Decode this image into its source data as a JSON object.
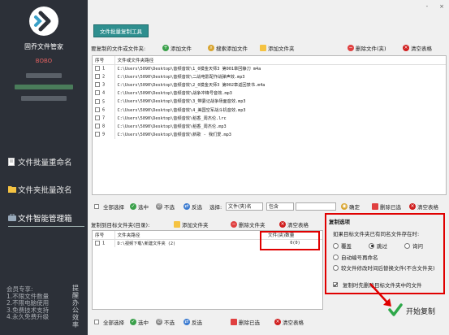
{
  "sidebar": {
    "app_name": "固乔文件管家",
    "version": "BOBO",
    "nav": [
      {
        "label": "文件批量重命名",
        "icon": "document-icon"
      },
      {
        "label": "文件夹批量改名",
        "icon": "folder-icon"
      },
      {
        "label": "文件智能管理箱",
        "icon": "toolbox-icon",
        "active": true
      }
    ],
    "promo_lines": [
      "会员专享:",
      "1.不限文件数量",
      "2.不限电脑使用",
      "3.免费技术支持",
      "4.永久免费升级"
    ],
    "promo_side": "提醒办公效率"
  },
  "window": {
    "minimize": "-",
    "close": "×"
  },
  "tab_button": "文件批量复制工具",
  "top_toolbar": {
    "label": "要复制的文件或文件夹:",
    "add_file": "添加文件",
    "search_add": "搜索添加文件",
    "add_folder": "添加文件夹",
    "delete": "删除文件(夹)",
    "clear": "清空表格"
  },
  "file_table": {
    "headers": [
      "序号",
      "文件或文件夹路径"
    ],
    "rows": [
      {
        "no": "1",
        "path": "C:\\Users\\5090\\Desktop\\音频音效\\1_0摸金天师3 第001章回静刀 m4a"
      },
      {
        "no": "2",
        "path": "C:\\Users\\5090\\Desktop\\音频音效\\二战电影配作战弹声效.mp3"
      },
      {
        "no": "3",
        "path": "C:\\Users\\5090\\Desktop\\音频音效\\2_0摸金天师3 第002章返回禁书.m4a"
      },
      {
        "no": "4",
        "path": "C:\\Users\\5090\\Desktop\\音频音效\\战争冲锋号音效.mp3"
      },
      {
        "no": "5",
        "path": "C:\\Users\\5090\\Desktop\\音频音效\\3_带委记战争场面音效.mp3"
      },
      {
        "no": "6",
        "path": "C:\\Users\\5090\\Desktop\\音频音效\\4_美国空军战斗机音效.mp3"
      },
      {
        "no": "7",
        "path": "C:\\Users\\5090\\Desktop\\音频音效\\稻香_周杰伦.lrc"
      },
      {
        "no": "8",
        "path": "C:\\Users\\5090\\Desktop\\音频音效\\稻香_周杰伦.mp3"
      },
      {
        "no": "9",
        "path": "C:\\Users\\5090\\Desktop\\音频音效\\新歌 - 我们爱.mp3"
      }
    ]
  },
  "select_bar": {
    "select_all": "全部选择",
    "select": "选中",
    "deselect": "不选",
    "invert": "反选",
    "choose_label": "选择:",
    "field_option": "文件(夹)名",
    "match_option": "包含",
    "confirm": "确定",
    "delete_selected": "删除已选",
    "clear": "清空表格"
  },
  "target_toolbar": {
    "label": "复制到目标文件夹(目录):",
    "add_folder": "添加文件夹",
    "delete": "删除文件夹",
    "clear": "清空表格"
  },
  "target_table": {
    "headers": [
      "序号",
      "文件夹路径",
      "文件(夹)数量"
    ],
    "rows": [
      {
        "no": "1",
        "path": "D:\\视频下载\\新建文件夹 (2)",
        "count": "0(0)"
      }
    ]
  },
  "bottom_bar": {
    "select_all": "全部选择",
    "select": "选中",
    "deselect": "不选",
    "invert": "反选",
    "delete_selected": "删除已选",
    "clear": "清空表格"
  },
  "options": {
    "title": "复制选项",
    "question": "如果目标文件夹已有同名文件存在时:",
    "overwrite": "覆盖",
    "skip": "跳过",
    "ask": "询问",
    "auto_rename": "自动编号再命名",
    "replace_newer": "较文件修改时间后替换文件(不含文件夹)",
    "delete_first": "复制时先删除目标文件夹中的文件",
    "selected_mode": "skip"
  },
  "start_button": "开始复制",
  "colors": {
    "sidebar": "#2c3038",
    "accent": "#2f8f8f",
    "highlight": "#e00000"
  }
}
